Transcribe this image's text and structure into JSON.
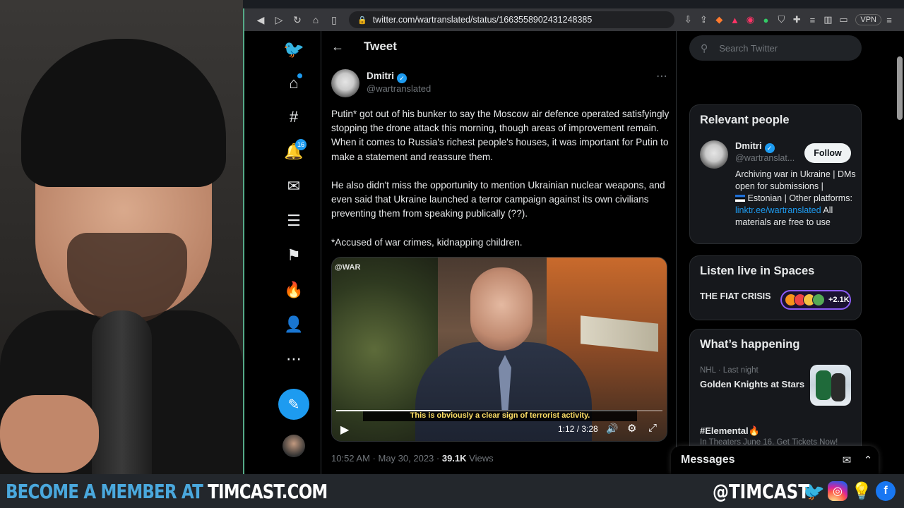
{
  "browser": {
    "url": "twitter.com/wartranslated/status/1663558902431248385",
    "vpn_label": "VPN"
  },
  "nav": {
    "notifications_badge": "16"
  },
  "tweet": {
    "header_title": "Tweet",
    "author_name": "Dmitri",
    "author_handle": "@wartranslated",
    "paragraphs": [
      "Putin* got out of his bunker to say the Moscow air defence operated satisfyingly stopping the drone attack this morning, though areas of improvement remain. When it comes to Russia's richest people's houses, it was important for Putin to make a statement and reassure them.",
      "He also didn't miss the opportunity to mention Ukrainian nuclear weapons, and even said that Ukraine launched a terror campaign against its own civilians preventing them from speaking publically (??).",
      "*Accused of war crimes, kidnapping children."
    ],
    "video": {
      "watermark": "@WAR",
      "caption": "This is obviously a clear sign of terrorist activity.",
      "time": "1:12 / 3:28",
      "progress": 0.35
    },
    "time": "10:52 AM",
    "date": "May 30, 2023",
    "views_count": "39.1K",
    "views_label": "Views"
  },
  "sidebar": {
    "search_placeholder": "Search Twitter",
    "relevant_title": "Relevant people",
    "person": {
      "name": "Dmitri",
      "handle": "@wartranslat...",
      "follow_label": "Follow",
      "bio_part1": "Archiving war in Ukraine | DMs open for submissions |",
      "bio_part2": "Estonian | Other platforms:",
      "bio_link": "linktr.ee/wartranslated",
      "bio_part3": "All materials are free to use"
    },
    "spaces_title": "Listen live in Spaces",
    "space_name": "THE FIAT CRISIS",
    "space_count": "+2.1K",
    "happening_title": "What’s happening",
    "trend1_meta": "NHL · Last night",
    "trend1_title": "Golden Knights at Stars",
    "trend2_title": "#Elemental🔥",
    "trend2_sub": "In Theaters June 16. Get Tickets Now!"
  },
  "messages": {
    "title": "Messages"
  },
  "banner": {
    "left_prefix": "BECOME A MEMBER AT ",
    "left_site": "TIMCAST.COM",
    "handle": "@TIMCAST"
  }
}
